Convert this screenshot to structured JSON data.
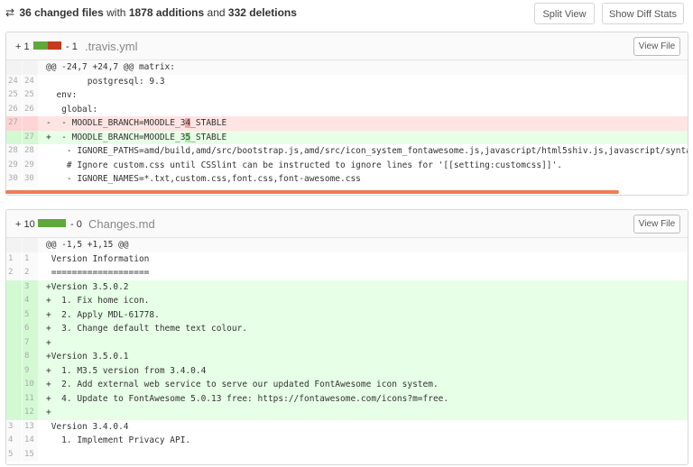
{
  "summary": {
    "icon": "sync-icon",
    "changed_files": "36 changed files",
    "with_text": "with",
    "additions": "1878 additions",
    "and_text": "and",
    "deletions": "332 deletions"
  },
  "toolbar": {
    "split_view": "Split View",
    "show_diff_stats": "Show Diff Stats"
  },
  "colors": {
    "add": "#5fa83b",
    "del": "#c63a1d",
    "accent": "#ef7c56"
  },
  "files": [
    {
      "plus": "+ 1",
      "minus": "- 1",
      "name": ".travis.yml",
      "view_file": "View File",
      "stat_add_fraction": 0.5,
      "rows": [
        {
          "type": "hunk",
          "l": "",
          "r": "",
          "code": "@@ -24,7 +24,7 @@ matrix:"
        },
        {
          "type": "ctx",
          "l": "24",
          "r": "24",
          "code": "        postgresql: 9.3"
        },
        {
          "type": "ctx",
          "l": "25",
          "r": "25",
          "code": "  env:"
        },
        {
          "type": "ctx",
          "l": "26",
          "r": "26",
          "code": "   global:"
        },
        {
          "type": "del",
          "l": "27",
          "r": "",
          "pre": "-  - MOODLE_BRANCH=MOODLE_3",
          "hl": "4",
          "post": "_STABLE"
        },
        {
          "type": "add",
          "l": "",
          "r": "27",
          "pre": "+  - MOODLE_BRANCH=MOODLE_3",
          "hl": "5",
          "post": "_STABLE"
        },
        {
          "type": "ctx",
          "l": "28",
          "r": "28",
          "code": "    - IGNORE_PATHS=amd/build,amd/src/bootstrap.js,amd/src/icon_system_fontawesome.js,javascript/html5shiv.js,javascript/syntaxhighlig"
        },
        {
          "type": "ctx",
          "l": "29",
          "r": "29",
          "code": "    # Ignore custom.css until CSSlint can be instructed to ignore lines for '[[setting:customcss]]'."
        },
        {
          "type": "ctx",
          "l": "30",
          "r": "30",
          "code": "    - IGNORE_NAMES=*.txt,custom.css,font.css,font-awesome.css"
        }
      ]
    },
    {
      "plus": "+ 10",
      "minus": "- 0",
      "name": "Changes.md",
      "view_file": "View File",
      "stat_add_fraction": 1.0,
      "rows": [
        {
          "type": "hunk",
          "l": "",
          "r": "",
          "code": "@@ -1,5 +1,15 @@"
        },
        {
          "type": "ctx",
          "l": "1",
          "r": "1",
          "code": " Version Information"
        },
        {
          "type": "ctx",
          "l": "2",
          "r": "2",
          "code": " ==================="
        },
        {
          "type": "add",
          "l": "",
          "r": "3",
          "code": "+Version 3.5.0.2"
        },
        {
          "type": "add",
          "l": "",
          "r": "4",
          "code": "+  1. Fix home icon."
        },
        {
          "type": "add",
          "l": "",
          "r": "5",
          "code": "+  2. Apply MDL-61778."
        },
        {
          "type": "add",
          "l": "",
          "r": "6",
          "code": "+  3. Change default theme text colour."
        },
        {
          "type": "add",
          "l": "",
          "r": "7",
          "code": "+"
        },
        {
          "type": "add",
          "l": "",
          "r": "8",
          "code": "+Version 3.5.0.1"
        },
        {
          "type": "add",
          "l": "",
          "r": "9",
          "code": "+  1. M3.5 version from 3.4.0.4"
        },
        {
          "type": "add",
          "l": "",
          "r": "10",
          "code": "+  2. Add external web service to serve our updated FontAwesome icon system."
        },
        {
          "type": "add",
          "l": "",
          "r": "11",
          "code": "+  4. Update to FontAwesome 5.0.13 free: https://fontawesome.com/icons?m=free."
        },
        {
          "type": "add",
          "l": "",
          "r": "12",
          "code": "+"
        },
        {
          "type": "ctx",
          "l": "3",
          "r": "13",
          "code": " Version 3.4.0.4"
        },
        {
          "type": "ctx",
          "l": "4",
          "r": "14",
          "code": "   1. Implement Privacy API."
        },
        {
          "type": "ctx",
          "l": "5",
          "r": "15",
          "code": ""
        }
      ]
    }
  ]
}
